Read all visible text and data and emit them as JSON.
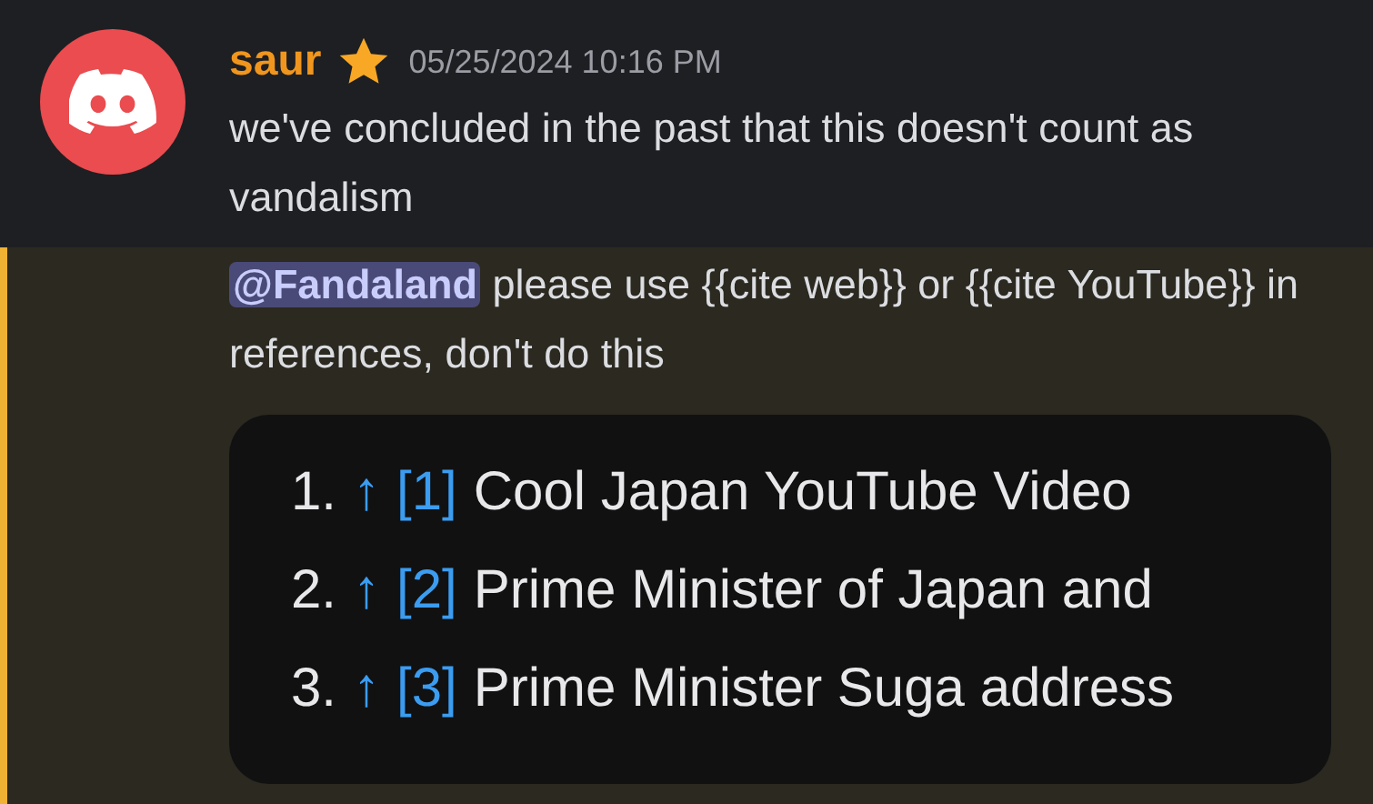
{
  "messages": [
    {
      "author": "saur",
      "timestamp": "05/25/2024 10:16 PM",
      "text": "we've concluded in the past that this doesn't count as vandalism"
    },
    {
      "mentions_me": true,
      "mention": "@Fandaland",
      "text": "please use {{cite web}} or {{cite YouTube}} in references, don't do this"
    }
  ],
  "embedded_list": [
    {
      "number": "1.",
      "arrow": "↑",
      "ref": "[1]",
      "title": "Cool Japan YouTube Video"
    },
    {
      "number": "2.",
      "arrow": "↑",
      "ref": "[2]",
      "title": "Prime Minister of Japan and"
    },
    {
      "number": "3.",
      "arrow": "↑",
      "ref": "[3]",
      "title": "Prime Minister Suga address"
    }
  ]
}
